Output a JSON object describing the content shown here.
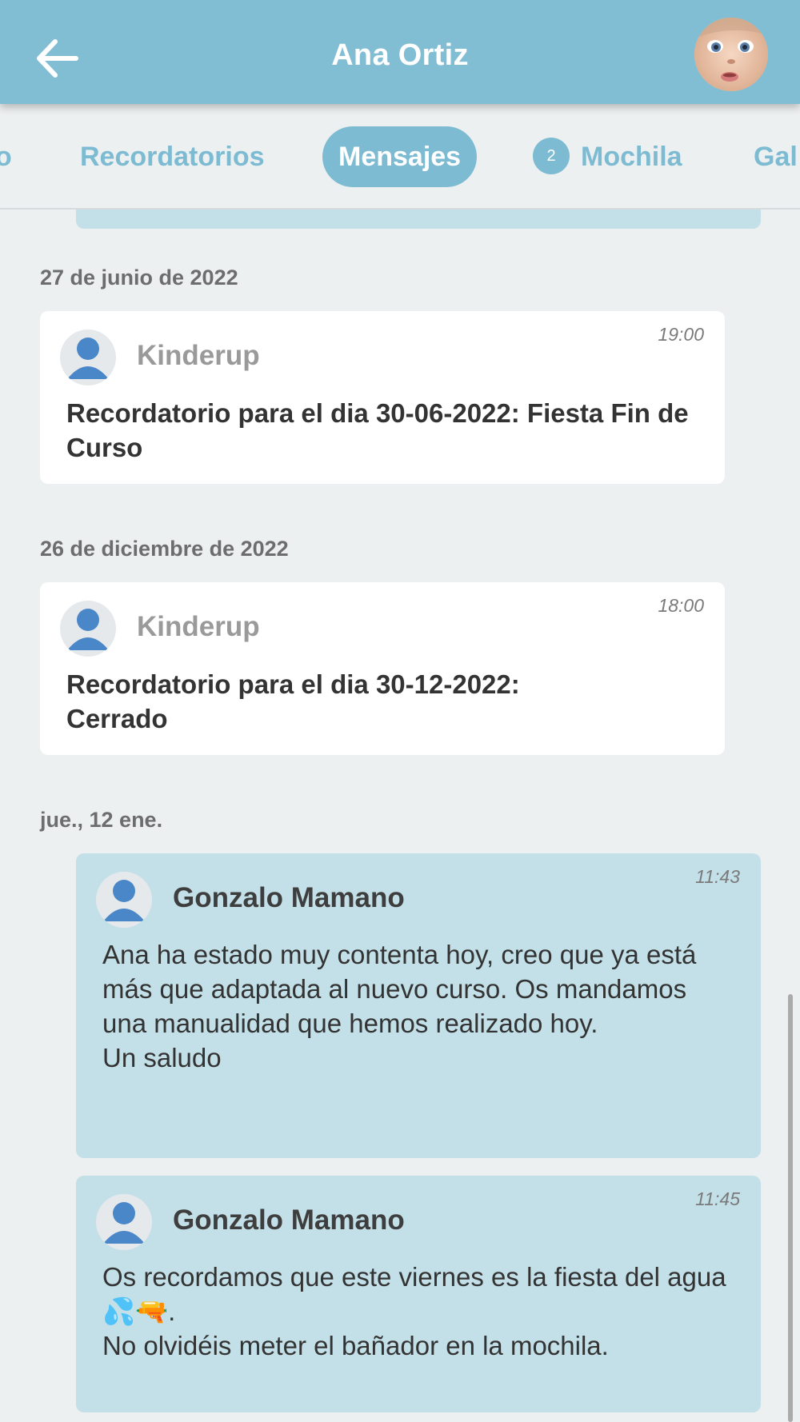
{
  "header": {
    "title": "Ana Ortiz",
    "back_icon": "arrow-left-icon",
    "avatar": "child-photo"
  },
  "tabs": [
    {
      "label": "o"
    },
    {
      "label": "Recordatorios"
    },
    {
      "label": "Mensajes",
      "active": true
    },
    {
      "label": "Mochila",
      "badge": "2"
    },
    {
      "label": "Gal"
    }
  ],
  "feed": [
    {
      "date": "27 de junio de 2022",
      "time": "19:00",
      "sender": "Kinderup",
      "text": "Recordatorio para el dia 30-06-2022: Fiesta Fin de Curso"
    },
    {
      "date": "26 de diciembre de 2022",
      "time": "18:00",
      "sender": "Kinderup",
      "text": "Recordatorio para el dia 30-12-2022: Cerrado"
    },
    {
      "date": "jue., 12 ene.",
      "time": "11:43",
      "sender": "Gonzalo Mamano",
      "text": "Ana ha estado muy contenta hoy, creo que ya está más que adaptada al nuevo curso. Os mandamos una manualidad que hemos realizado hoy.\nUn saludo"
    },
    {
      "time": "11:45",
      "sender": "Gonzalo Mamano",
      "text": "Os recordamos que este viernes es la fiesta del agua 💦🔫.\nNo olvidéis meter el bañador en la mochila."
    }
  ],
  "colors": {
    "header": "#82bed3",
    "accent": "#7dbbd2",
    "card_blue": "#c3e0e8",
    "background": "#edf0f1",
    "avatar_icon": "#4a87c8"
  }
}
